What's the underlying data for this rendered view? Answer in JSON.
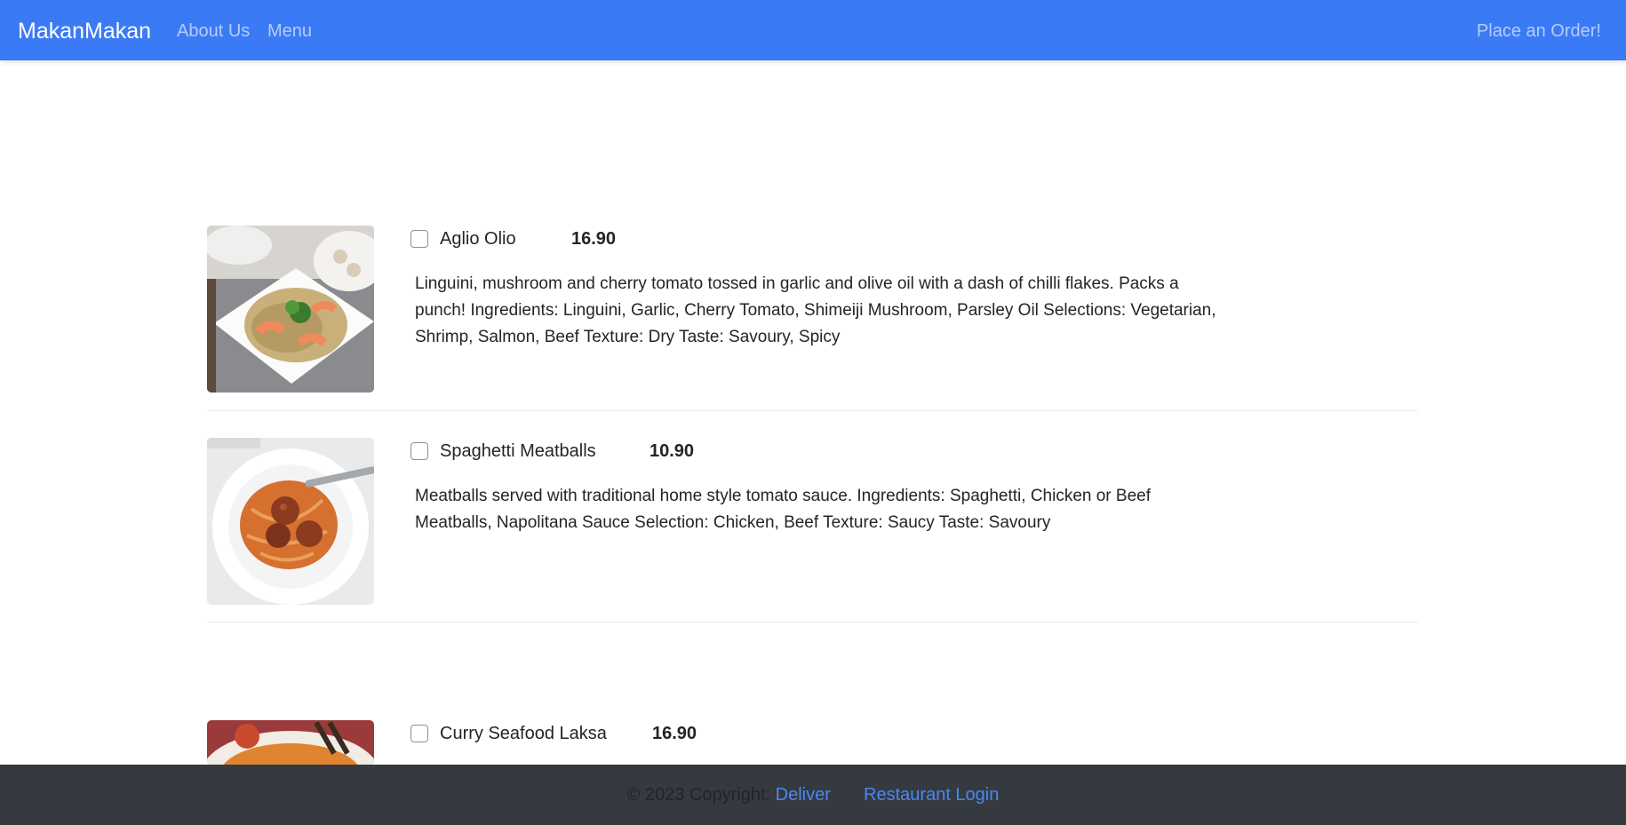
{
  "navbar": {
    "brand": "MakanMakan",
    "links": [
      "About Us",
      "Menu"
    ],
    "order_label": "Place an Order!"
  },
  "menu": {
    "items": [
      {
        "name": "Aglio Olio",
        "price": "16.90",
        "description": "Linguini, mushroom and cherry tomato tossed in garlic and olive oil with a dash of chilli flakes. Packs a punch! Ingredients: Linguini, Garlic, Cherry Tomato, Shimeiji Mushroom, Parsley Oil Selections: Vegetarian, Shrimp, Salmon, Beef Texture: Dry Taste: Savoury, Spicy"
      },
      {
        "name": "Spaghetti Meatballs",
        "price": "10.90",
        "description": "Meatballs served with traditional home style tomato sauce. Ingredients: Spaghetti, Chicken or Beef Meatballs, Napolitana Sauce Selection: Chicken, Beef Texture: Saucy Taste: Savoury"
      },
      {
        "name": "Curry Seafood Laksa",
        "price": "16.90",
        "description": ""
      }
    ]
  },
  "footer": {
    "copyright": "© 2023 Copyright:",
    "deliver_link": "Deliver",
    "login_link": "Restaurant Login"
  },
  "colors": {
    "navbar": "#3b7af5",
    "footer": "#343a40",
    "link": "#4a87f5"
  }
}
